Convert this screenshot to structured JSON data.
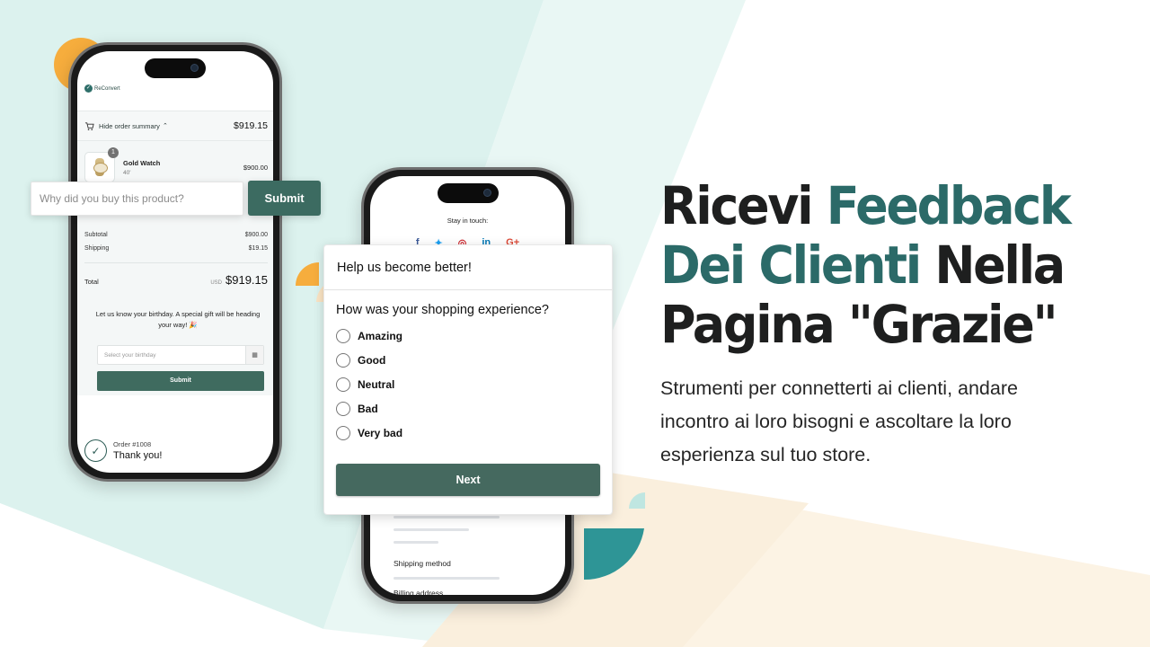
{
  "colors": {
    "accent_teal": "#2b6a68",
    "button_green": "#3c6b61",
    "orange": "#f6ad3d",
    "mint_bg": "#dcf2ee",
    "cream_bg": "#fcf3e4",
    "dark_teal_shape": "#2e9596"
  },
  "phone1": {
    "brand": "ReConvert",
    "summary_toggle": "Hide order summary",
    "summary_chevron_icon": "chevron-up-icon",
    "summary_total": "$919.15",
    "item": {
      "quantity": "1",
      "name": "Gold Watch",
      "variant": "40'",
      "price": "$900.00"
    },
    "subtotal_label": "Subtotal",
    "subtotal_value": "$900.00",
    "shipping_label": "Shipping",
    "shipping_value": "$19.15",
    "total_label": "Total",
    "total_currency": "USD",
    "total_value": "$919.15",
    "birthday_message": "Let us know your birthday. A special gift will be heading your way! 🎉",
    "birthday_placeholder": "Select your birthday",
    "birthday_submit": "Submit",
    "order_number": "Order #1008",
    "thank_you": "Thank you!"
  },
  "why_widget": {
    "placeholder": "Why did you buy this product?",
    "submit": "Submit"
  },
  "phone2": {
    "stay_in_touch": "Stay in touch:",
    "socials": [
      {
        "icon": "facebook-icon",
        "glyph": "f",
        "color": "#3b5998"
      },
      {
        "icon": "twitter-icon",
        "glyph": "🐦",
        "color": "#1da1f2"
      },
      {
        "icon": "pinterest-icon",
        "glyph": "◎",
        "color": "#cb2027"
      },
      {
        "icon": "linkedin-icon",
        "glyph": "in",
        "color": "#0077b5"
      },
      {
        "icon": "google-plus-icon",
        "glyph": "G+",
        "color": "#dd4b39"
      }
    ],
    "shipping_method": "Shipping method",
    "billing_address": "Billing address"
  },
  "survey": {
    "title": "Help us become better!",
    "question": "How was your shopping experience?",
    "options": [
      "Amazing",
      "Good",
      "Neutral",
      "Bad",
      "Very bad"
    ],
    "next": "Next"
  },
  "headline": {
    "line1_a": "Ricevi ",
    "line1_b": "Feedback",
    "line2_a": "Dei Clienti",
    "line2_b": " Nella",
    "line3": "Pagina \"Grazie\""
  },
  "subtext": "Strumenti per connetterti ai clienti, andare incontro ai loro bisogni e ascoltare la loro esperienza sul tuo store."
}
